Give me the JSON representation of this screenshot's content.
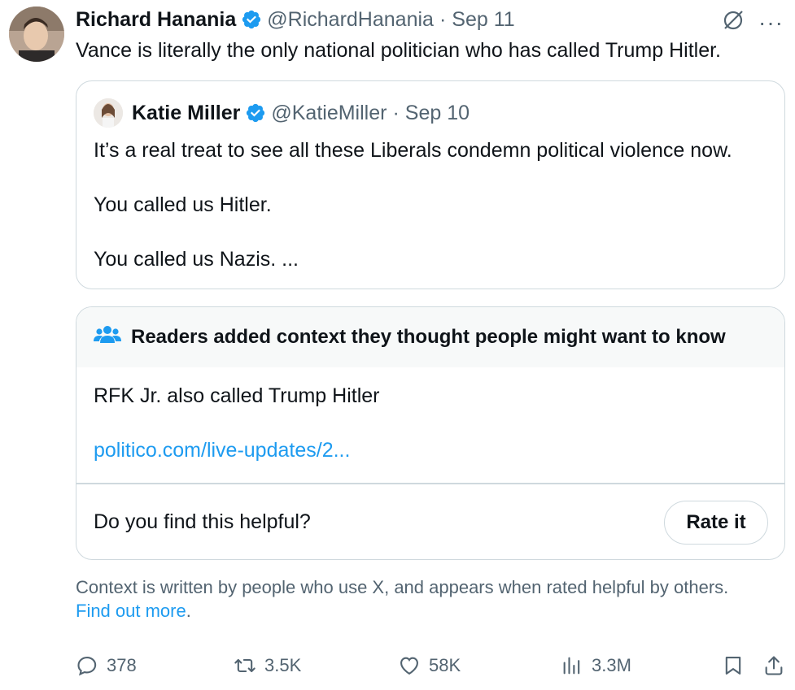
{
  "author": {
    "name": "Richard Hanania",
    "handle": "@RichardHanania",
    "separator": "·",
    "date": "Sep 11"
  },
  "tweet_text": "Vance is literally the only national politician who has called Trump Hitler.",
  "quoted": {
    "name": "Katie Miller",
    "handle": "@KatieMiller",
    "separator": "·",
    "date": "Sep 10",
    "lines": [
      "It’s a real treat to see all these Liberals condemn political violence now.",
      "You called us Hitler.",
      "You called us Nazis. ..."
    ]
  },
  "community_note": {
    "header": "Readers added context they thought people might want to know",
    "body": "RFK Jr. also called Trump Hitler",
    "link": "politico.com/live-updates/2...",
    "helpful_prompt": "Do you find this helpful?",
    "rate_button": "Rate it"
  },
  "context_info": {
    "text": "Context is written by people who use X, and appears when rated helpful by others.",
    "link": "Find out more",
    "suffix": "."
  },
  "actions": {
    "replies": "378",
    "reposts": "3.5K",
    "likes": "58K",
    "views": "3.3M"
  },
  "colors": {
    "accent": "#1d9bf0",
    "secondary_text": "#536471",
    "border": "#cfd9de"
  },
  "icons": [
    "grok-icon",
    "more-icon",
    "verified-badge-icon",
    "people-icon",
    "reply-icon",
    "repost-icon",
    "like-icon",
    "views-icon",
    "bookmark-icon",
    "share-icon"
  ]
}
